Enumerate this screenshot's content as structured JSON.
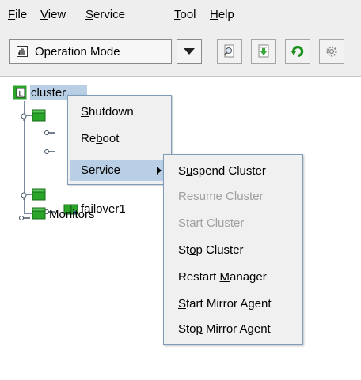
{
  "menubar": {
    "items": [
      {
        "mnemonic": "F",
        "rest": "ile"
      },
      {
        "mnemonic": "V",
        "rest": "iew"
      },
      {
        "mnemonic": "S",
        "rest": "ervice"
      },
      {
        "mnemonic": "T",
        "rest": "ool"
      },
      {
        "mnemonic": "H",
        "rest": "elp"
      }
    ]
  },
  "toolbar": {
    "mode_label": "Operation Mode",
    "mode_icon": "hand-icon",
    "buttons": [
      "magnifier-doc-icon",
      "download-doc-icon",
      "refresh-icon",
      "gear-icon"
    ]
  },
  "tree": {
    "root": "cluster",
    "nodes": {
      "failover": "failover1",
      "monitors": "Monitors"
    }
  },
  "context_menu": {
    "shutdown": {
      "mnemonic": "S",
      "rest": "hutdown"
    },
    "reboot": {
      "pre": "Re",
      "mnemonic": "b",
      "rest": "oot"
    },
    "service": "Service"
  },
  "service_submenu": {
    "suspend": {
      "pre": "S",
      "mnemonic": "u",
      "rest": "spend Cluster",
      "enabled": true
    },
    "resume": {
      "pre": "",
      "mnemonic": "R",
      "rest": "esume Cluster",
      "enabled": false
    },
    "start": {
      "pre": "St",
      "mnemonic": "a",
      "rest": "rt Cluster",
      "enabled": false
    },
    "stop": {
      "pre": "St",
      "mnemonic": "o",
      "rest": "p Cluster",
      "enabled": true
    },
    "restart_manager": {
      "pre": "Restart ",
      "mnemonic": "M",
      "rest": "anager",
      "enabled": true
    },
    "start_mirror": {
      "pre": "",
      "mnemonic": "S",
      "rest": "tart Mirror Agent",
      "enabled": true
    },
    "stop_mirror": {
      "pre": "Sto",
      "mnemonic": "p",
      "rest": " Mirror Agent",
      "enabled": true
    }
  },
  "colors": {
    "menu_bg": "#f0f0f0",
    "selection": "#b8cfe5",
    "disabled_text": "#a0a0a0",
    "server_green": "#2aa52a"
  }
}
